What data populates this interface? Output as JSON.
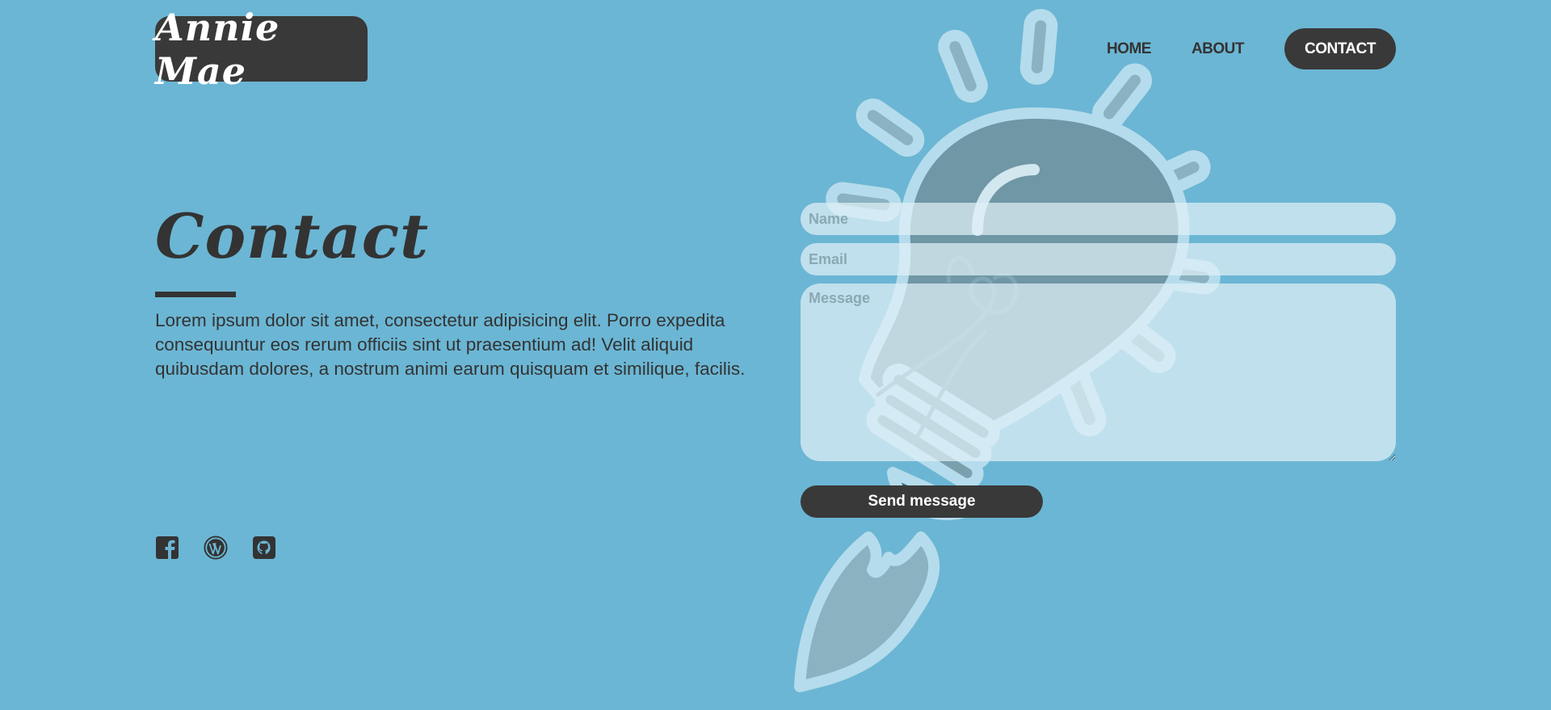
{
  "brand": {
    "logo_text": "Annie Mae"
  },
  "nav": {
    "home": "HOME",
    "about": "ABOUT",
    "contact": "CONTACT"
  },
  "hero": {
    "title": "Contact",
    "body": "Lorem ipsum dolor sit amet, consectetur adipisicing elit. Porro expedita consequuntur eos rerum officiis sint ut praesentium ad! Velit aliquid quibusdam dolores, a nostrum animi earum quisquam et similique, facilis."
  },
  "form": {
    "name_placeholder": "Name",
    "email_placeholder": "Email",
    "message_placeholder": "Message",
    "submit_label": "Send message"
  },
  "social": [
    {
      "icon": "facebook-icon"
    },
    {
      "icon": "wordpress-icon"
    },
    {
      "icon": "github-icon"
    }
  ],
  "colors": {
    "background": "#6bb6d4",
    "dark": "#393939",
    "text": "#333333",
    "field_bg": "rgba(225,240,246,0.72)"
  }
}
